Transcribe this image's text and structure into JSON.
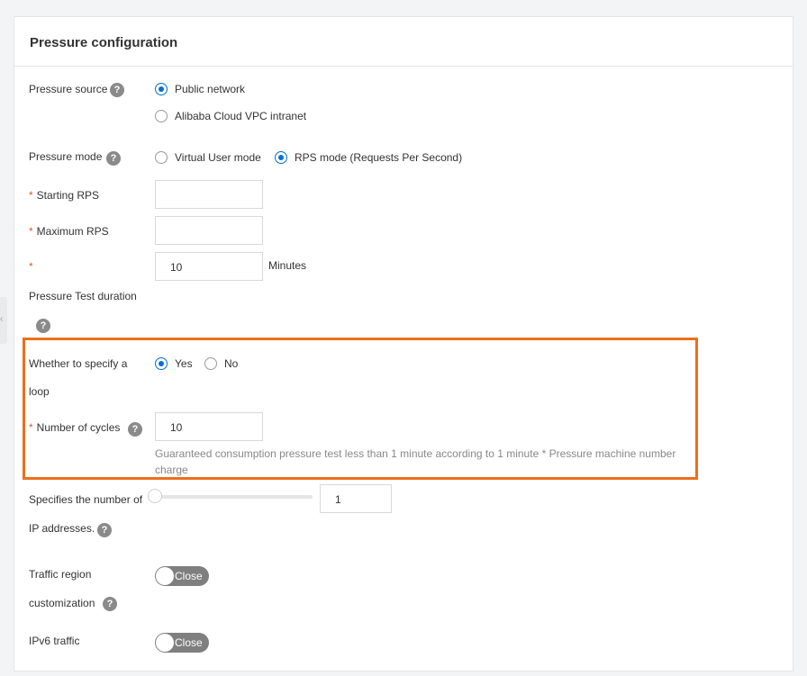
{
  "panel": {
    "title": "Pressure configuration"
  },
  "pressure_source": {
    "label": "Pressure source",
    "options": [
      "Public network",
      "Alibaba Cloud VPC intranet"
    ],
    "selected": "Public network"
  },
  "pressure_mode": {
    "label": "Pressure mode",
    "options": [
      "Virtual User mode",
      "RPS mode (Requests Per Second)"
    ],
    "selected": "RPS mode (Requests Per Second)"
  },
  "starting_rps": {
    "label": "Starting RPS",
    "value": ""
  },
  "maximum_rps": {
    "label": "Maximum RPS",
    "value": ""
  },
  "duration": {
    "label": "Pressure Test duration",
    "value": "10",
    "unit": "Minutes"
  },
  "loop": {
    "label_line1": "Whether to specify a",
    "label_line2": "loop",
    "options": [
      "Yes",
      "No"
    ],
    "selected": "Yes"
  },
  "cycles": {
    "label": "Number of cycles",
    "value": "10",
    "hint_line1": "Guaranteed consumption pressure test less than 1 minute according to 1 minute * Pressure machine number",
    "hint_line2": "charge"
  },
  "ip_count": {
    "label_line1": "Specifies the number of",
    "label_line2": "IP addresses.",
    "value": "1",
    "slider_fraction": 0
  },
  "traffic_region": {
    "label_line1": "Traffic region",
    "label_line2": "customization",
    "switch_text": "Close"
  },
  "ipv6": {
    "label": "IPv6 traffic",
    "switch_text": "Close"
  },
  "glyphs": {
    "help": "?",
    "required": "*",
    "collapse": "‹"
  },
  "colors": {
    "accent": "#0070cc",
    "required": "#e8572c",
    "highlight": "#ec6f1c",
    "switch_off": "#7f7f7f"
  }
}
